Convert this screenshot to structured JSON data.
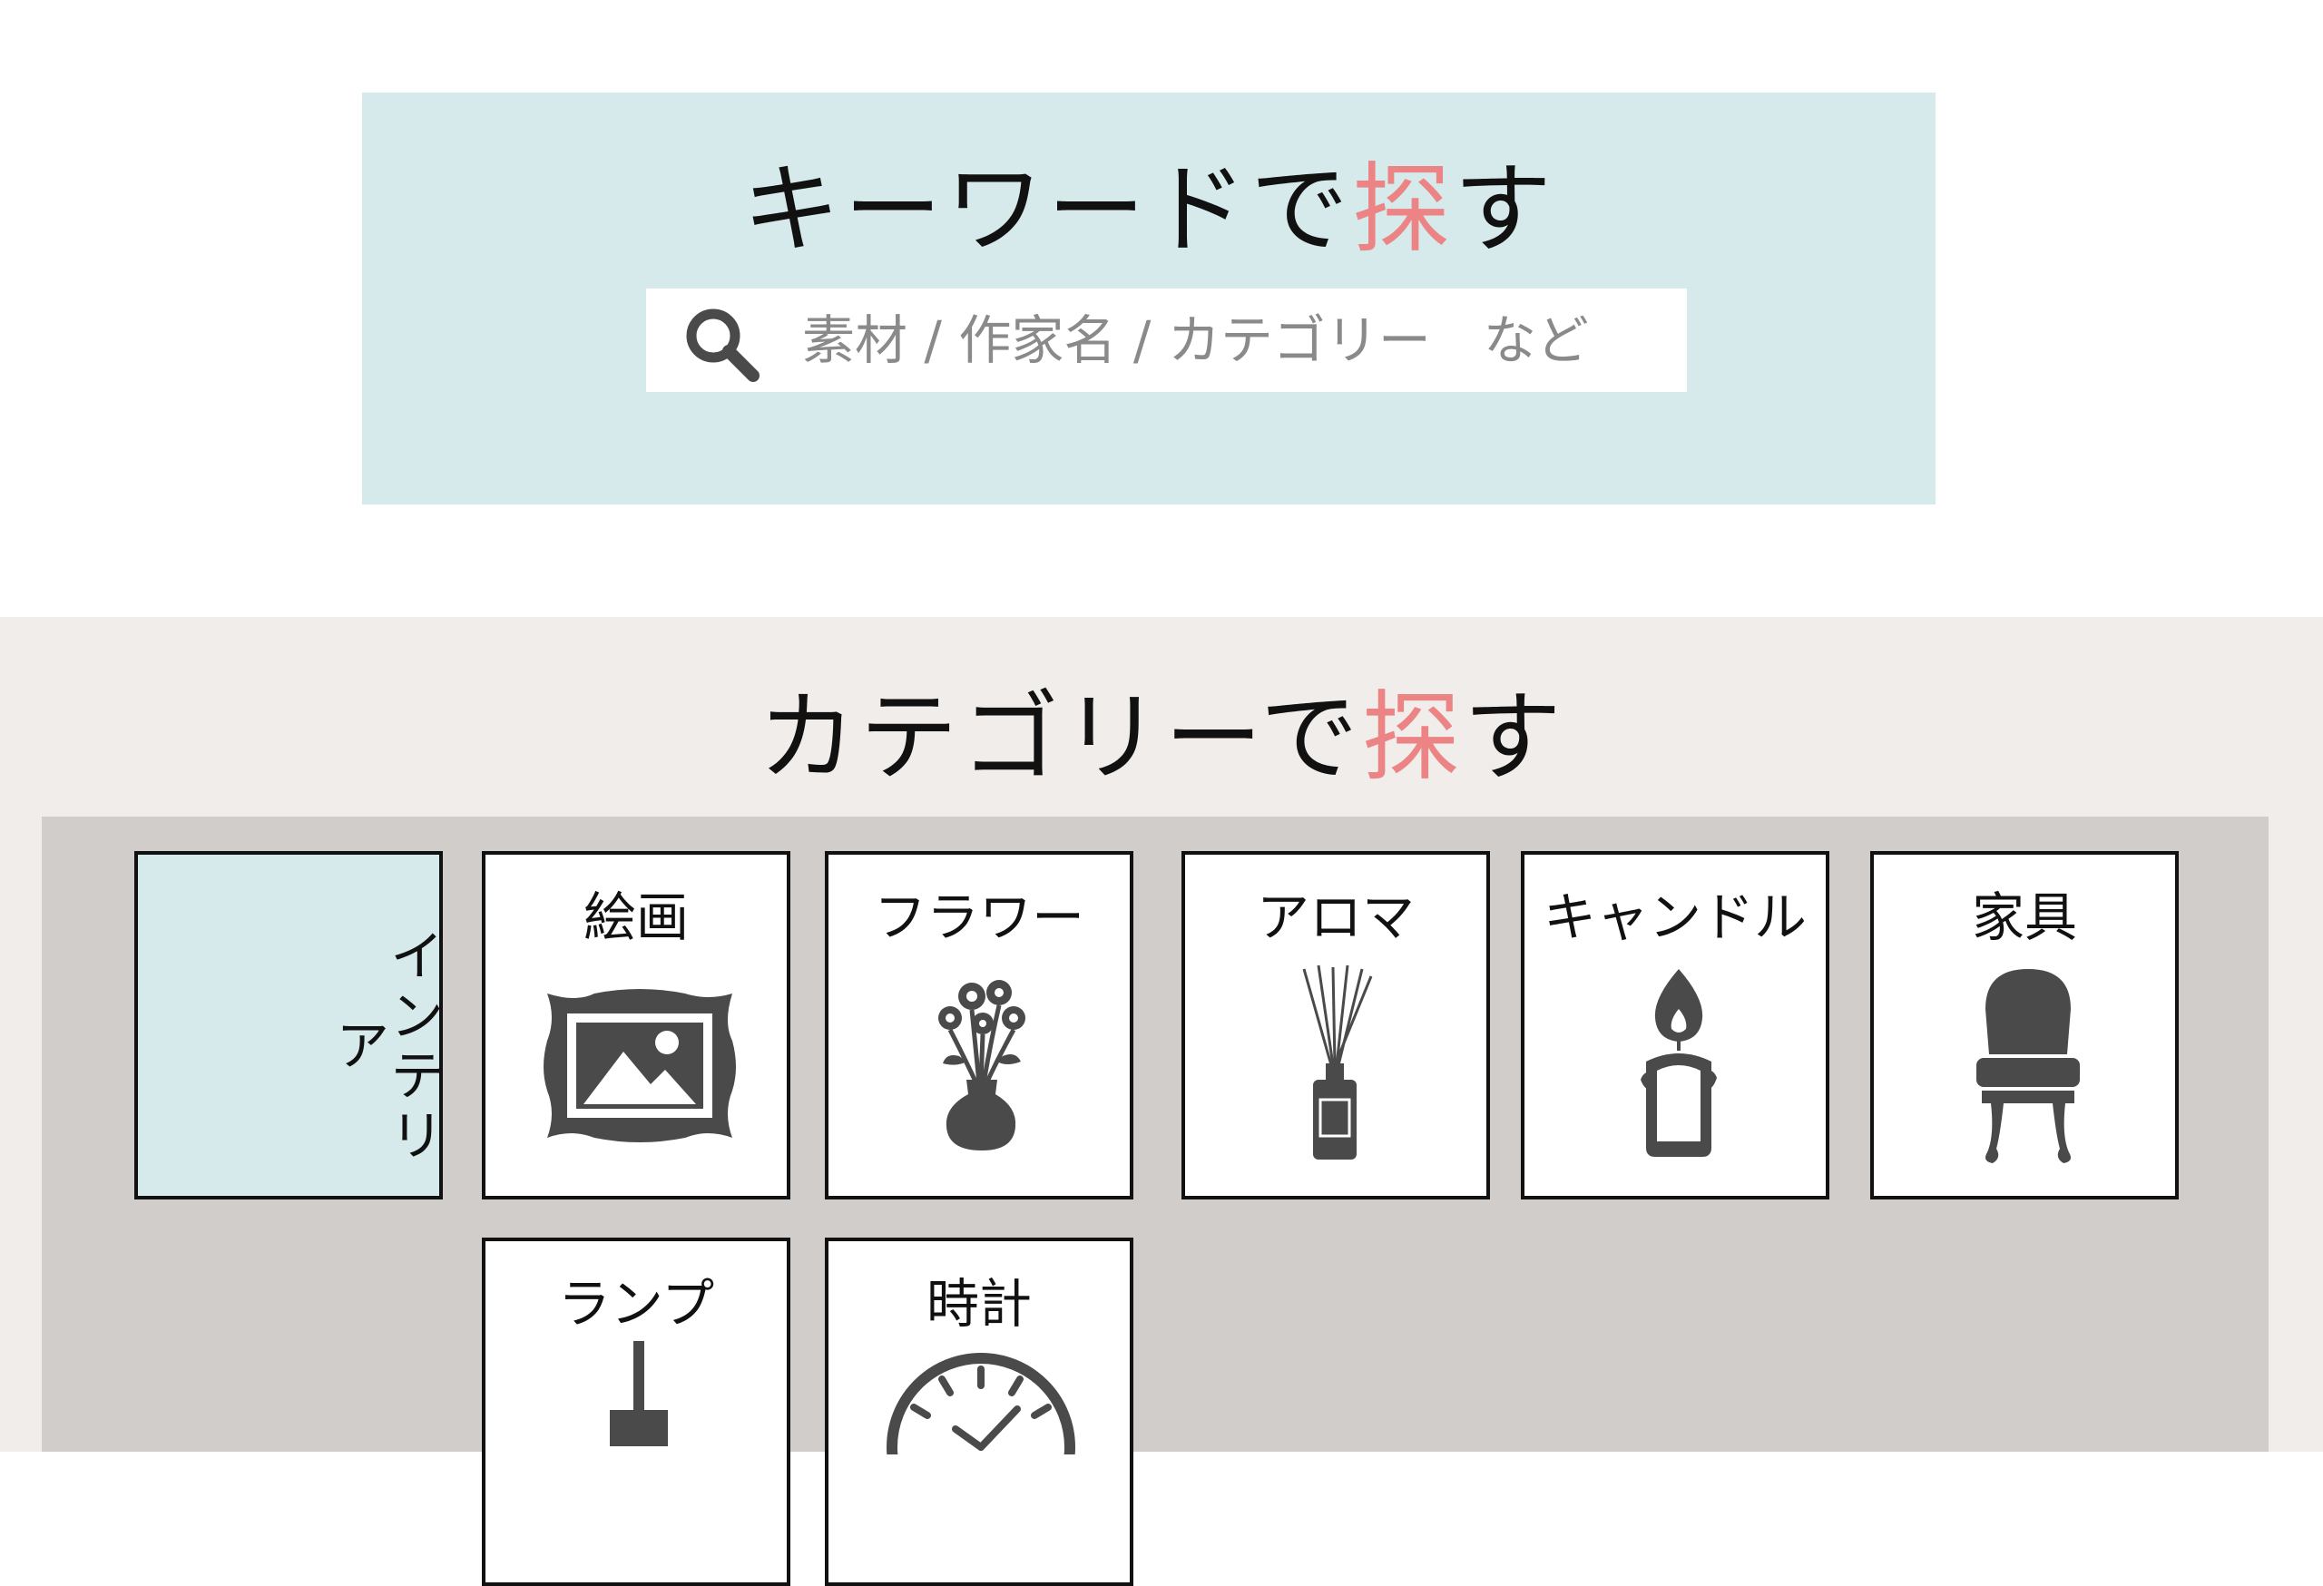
{
  "keyword_search": {
    "heading_pre": "キーワードで",
    "heading_hl": "探",
    "heading_post": "す",
    "placeholder": "素材 / 作家名 / カテゴリー　など"
  },
  "category_search": {
    "heading_pre": "カテゴリーで",
    "heading_hl": "探",
    "heading_post": "す",
    "active_tab": "インテリア",
    "categories": [
      {
        "label": "絵画",
        "icon": "framed-picture-icon"
      },
      {
        "label": "フラワー",
        "icon": "flower-vase-icon"
      },
      {
        "label": "アロマ",
        "icon": "reed-diffuser-icon"
      },
      {
        "label": "キャンドル",
        "icon": "candle-icon"
      },
      {
        "label": "家具",
        "icon": "chair-icon"
      },
      {
        "label": "ランプ",
        "icon": "lamp-icon"
      },
      {
        "label": "時計",
        "icon": "clock-icon"
      }
    ]
  },
  "colors": {
    "accent": "#ec8485",
    "panel_blue": "#d6e9eb",
    "section_bg": "#f0edea",
    "grid_bg": "#d0cdca",
    "icon": "#4a4a4a"
  }
}
